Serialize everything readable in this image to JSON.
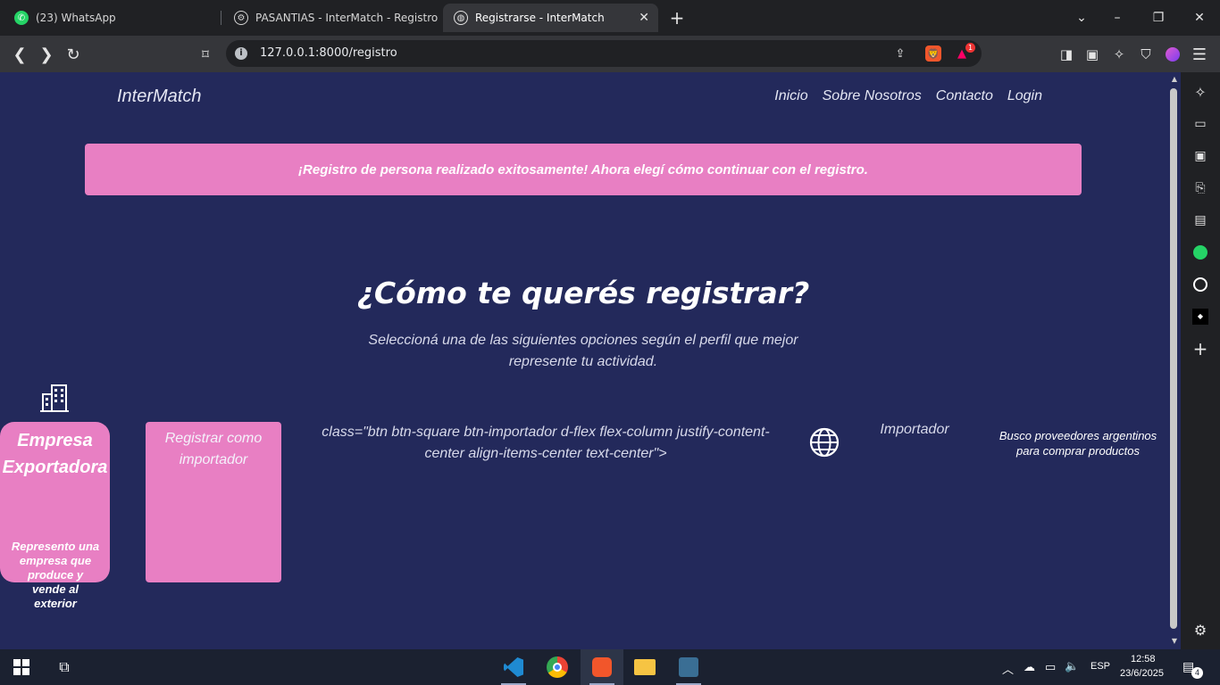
{
  "browser": {
    "tabs": [
      {
        "title": "(23) WhatsApp",
        "active": false
      },
      {
        "title": "PASANTIAS - InterMatch - Registro d",
        "active": false
      },
      {
        "title": "Registrarse - InterMatch",
        "active": true
      }
    ],
    "url": "127.0.0.1:8000/registro",
    "brave_badge_count": "1"
  },
  "page": {
    "brand": "InterMatch",
    "nav": [
      "Inicio",
      "Sobre Nosotros",
      "Contacto",
      "Login"
    ],
    "alert": "¡Registro de persona realizado exitosamente! Ahora elegí cómo continuar con el registro.",
    "heading": "¿Cómo te querés registrar?",
    "subtitle": "Seleccioná una de las siguientes opciones según el perfil que mejor represente tu actividad.",
    "exportadora": {
      "title": "Empresa Exportadora",
      "description": "Represento una empresa que produce y vende al exterior"
    },
    "importador_button": "Registrar como importador",
    "raw_attribute_text": "class=\"btn btn-square btn-importador d-flex flex-column justify-content-center align-items-center text-center\">",
    "importador": {
      "title": "Importador",
      "description": "Busco proveedores argentinos para comprar productos"
    }
  },
  "taskbar": {
    "language": "ESP",
    "time": "12:58",
    "date": "23/6/2025",
    "notifications": "4"
  },
  "colors": {
    "page_bg": "#23295b",
    "accent_pink": "#e87fc3",
    "chrome_dark": "#202124",
    "toolbar": "#35363a"
  }
}
